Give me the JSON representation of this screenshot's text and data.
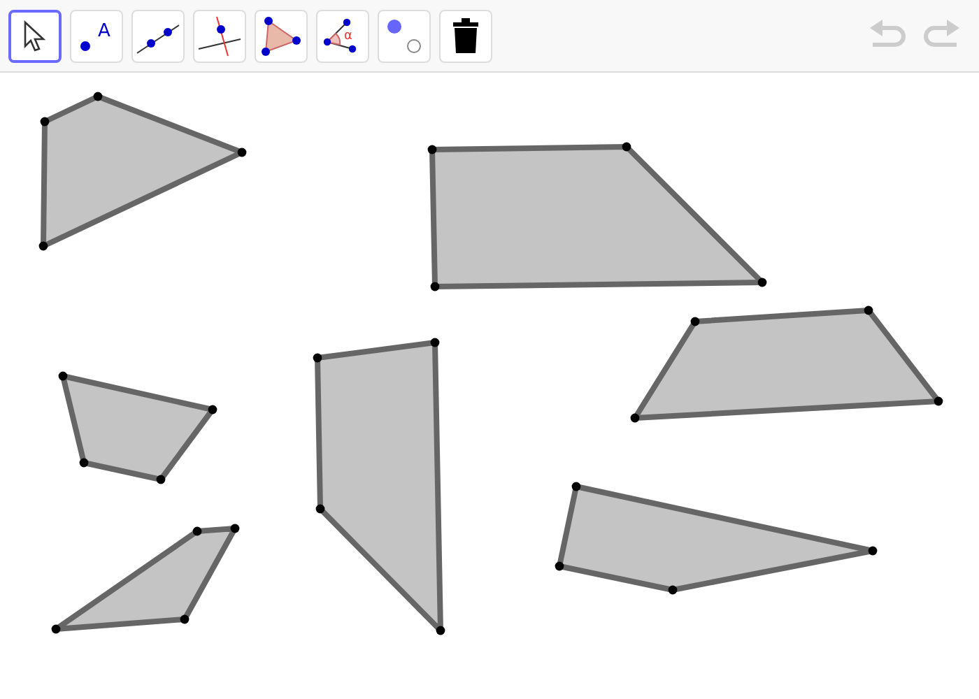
{
  "toolbar": {
    "tools": [
      {
        "kind": "move",
        "selected": true
      },
      {
        "kind": "point",
        "selected": false,
        "label": "A"
      },
      {
        "kind": "line",
        "selected": false
      },
      {
        "kind": "perpendicular",
        "selected": false
      },
      {
        "kind": "polygon",
        "selected": false
      },
      {
        "kind": "angle",
        "selected": false,
        "label": "α"
      },
      {
        "kind": "show-hide",
        "selected": false
      },
      {
        "kind": "delete",
        "selected": false
      }
    ],
    "undo": {
      "disabled": true
    },
    "redo": {
      "disabled": true
    }
  }
}
